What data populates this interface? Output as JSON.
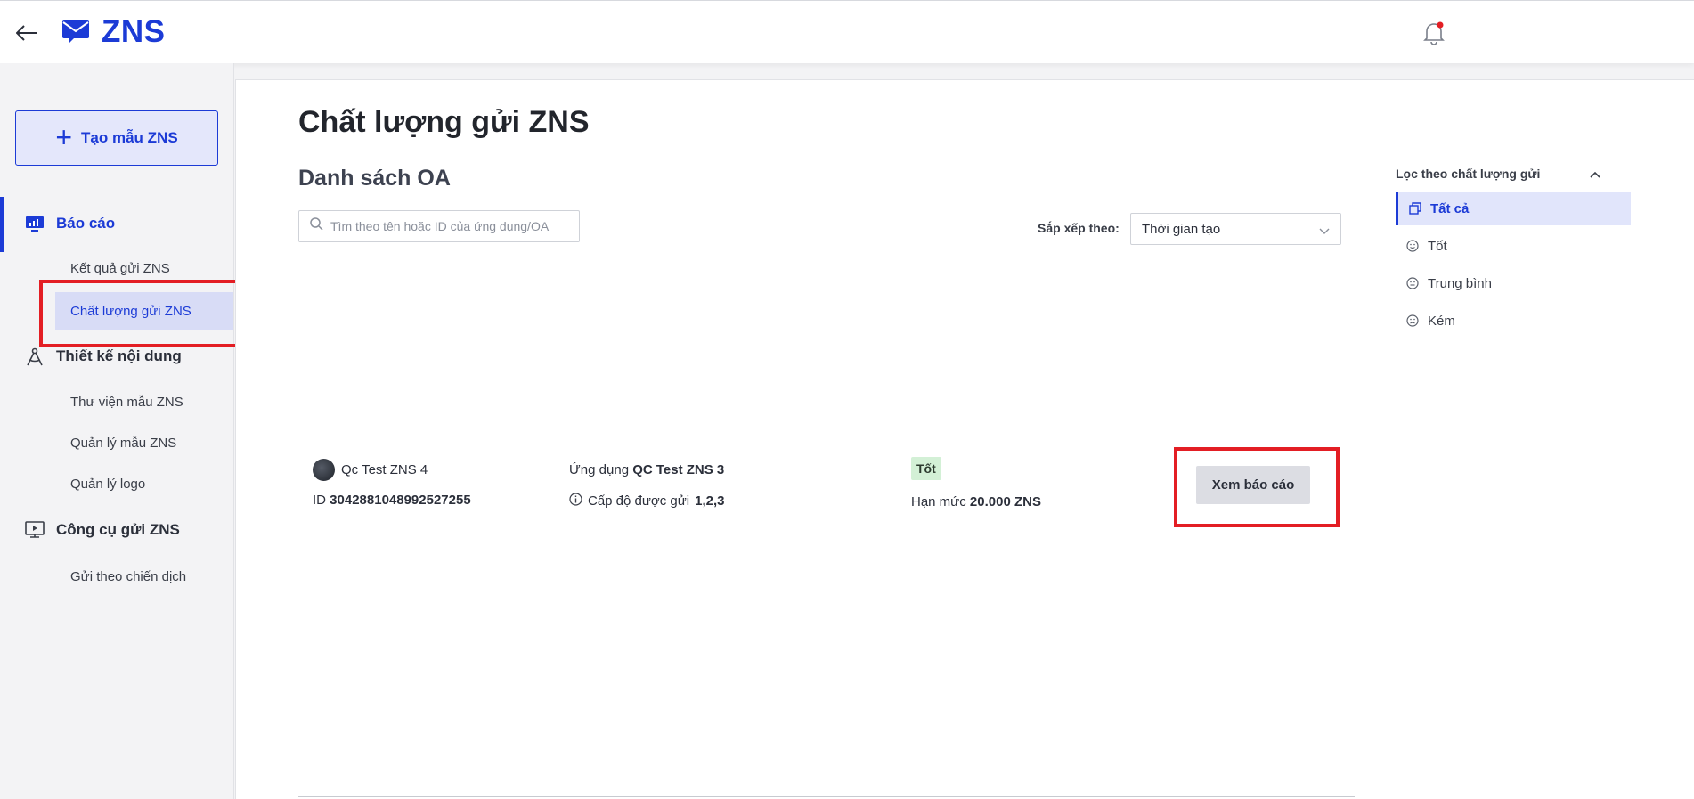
{
  "header": {
    "title": "ZNS"
  },
  "sidebar": {
    "create_label": "Tạo mẫu ZNS",
    "sections": [
      {
        "label": "Báo cáo",
        "items": [
          "Kết quả gửi ZNS",
          "Chất lượng gửi ZNS"
        ]
      },
      {
        "label": "Thiết kế nội dung",
        "items": [
          "Thư viện mẫu ZNS",
          "Quản lý mẫu ZNS",
          "Quản lý logo"
        ]
      },
      {
        "label": "Công cụ gửi ZNS",
        "items": [
          "Gửi theo chiến dịch"
        ]
      }
    ],
    "active_item": "Chất lượng gửi ZNS"
  },
  "main": {
    "title": "Chất lượng gửi ZNS",
    "subtitle": "Danh sách OA",
    "search_placeholder": "Tìm theo tên hoặc ID của ứng dụng/OA",
    "sort_label": "Sắp xếp theo:",
    "sort_value": "Thời gian tạo"
  },
  "filter": {
    "title": "Lọc theo chất lượng gửi",
    "options": [
      "Tất cả",
      "Tốt",
      "Trung bình",
      "Kém"
    ],
    "selected": "Tất cả"
  },
  "oa_row": {
    "name": "Qc Test ZNS 4",
    "id_prefix": "ID",
    "id": "3042881048992527255",
    "app_prefix": "Ứng dụng",
    "app_name": "QC Test ZNS 3",
    "level_prefix": "Cấp độ được gửi",
    "level": "1,2,3",
    "quality_badge": "Tốt",
    "quota_prefix": "Hạn mức",
    "quota": "20.000 ZNS",
    "view_button": "Xem báo cáo"
  },
  "colors": {
    "accent": "#1c3bd6",
    "highlight": "#e31e24",
    "good": "#d3f0d6"
  }
}
